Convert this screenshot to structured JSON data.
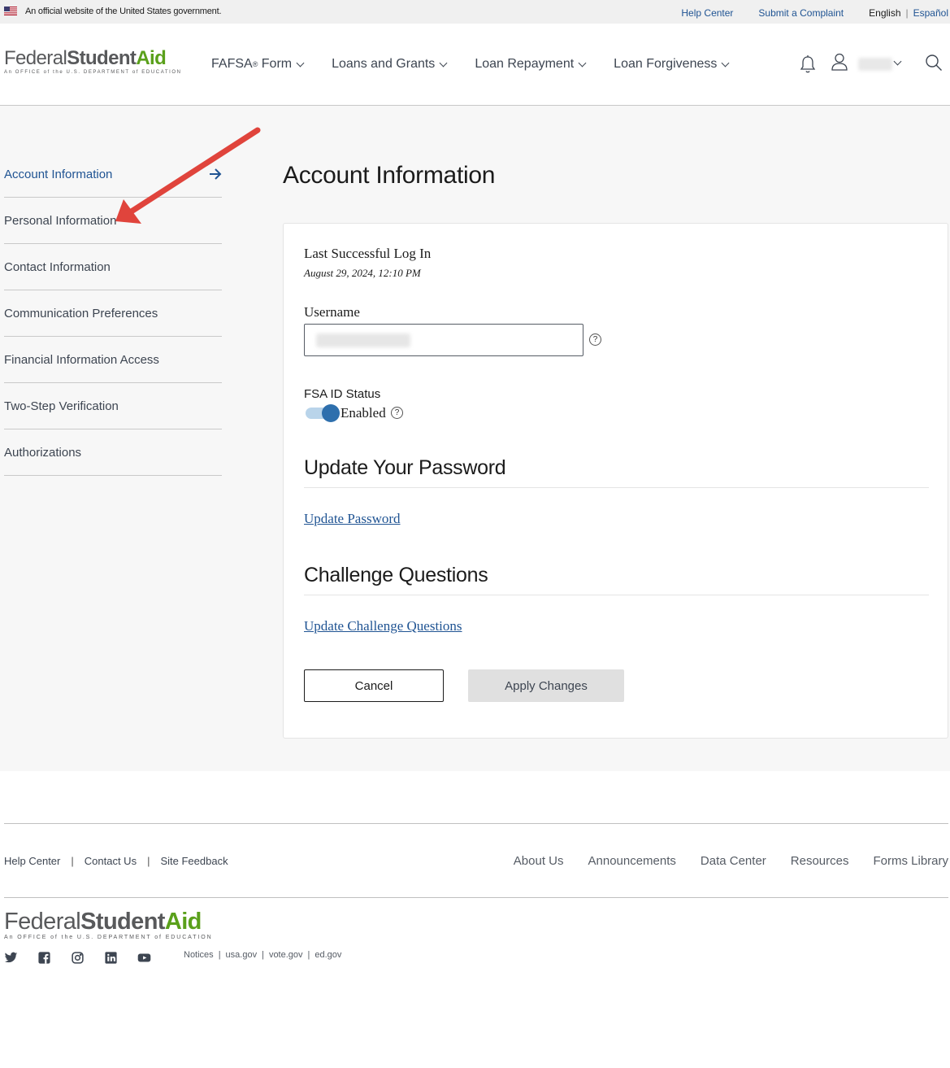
{
  "gov_banner": {
    "text": "An official website of the United States government.",
    "help_center": "Help Center",
    "submit_complaint": "Submit a Complaint",
    "lang_current": "English",
    "lang_separator": "|",
    "lang_other": "Español"
  },
  "logo": {
    "word1": "Federal",
    "word2": "Student",
    "word3": "Aid",
    "subtitle": "An OFFICE of the U.S. DEPARTMENT of EDUCATION"
  },
  "nav": {
    "fafsa": "FAFSA",
    "fafsa_reg": "®",
    "fafsa_form": " Form",
    "loans_grants": "Loans and Grants",
    "loan_repayment": "Loan Repayment",
    "loan_forgiveness": "Loan Forgiveness"
  },
  "sidebar": {
    "items": [
      {
        "label": "Account Information"
      },
      {
        "label": "Personal Information"
      },
      {
        "label": "Contact Information"
      },
      {
        "label": "Communication Preferences"
      },
      {
        "label": "Financial Information Access"
      },
      {
        "label": "Two-Step Verification"
      },
      {
        "label": "Authorizations"
      }
    ]
  },
  "main": {
    "title": "Account Information",
    "last_login_label": "Last Successful Log In",
    "last_login_value": "August 29, 2024, 12:10 PM",
    "username_label": "Username",
    "help_glyph": "?",
    "fsa_status_label": "FSA ID Status",
    "fsa_status_value": "Enabled",
    "password_section": "Update Your Password",
    "password_link": "Update Password",
    "challenge_section": "Challenge Questions",
    "challenge_link": "Update Challenge Questions",
    "cancel_button": "Cancel",
    "apply_button": "Apply Changes"
  },
  "footer": {
    "help_center": "Help Center",
    "contact_us": "Contact Us",
    "site_feedback": "Site Feedback",
    "sep": "|",
    "about_us": "About Us",
    "announcements": "Announcements",
    "data_center": "Data Center",
    "resources": "Resources",
    "forms_library": "Forms Library",
    "notices": "Notices",
    "usa_gov": "usa.gov",
    "vote_gov": "vote.gov",
    "ed_gov": "ed.gov"
  },
  "colors": {
    "link_blue": "#205493",
    "aid_green": "#5aa01b",
    "annotation_red": "#e0443c",
    "toggle_blue": "#2e6fad"
  }
}
